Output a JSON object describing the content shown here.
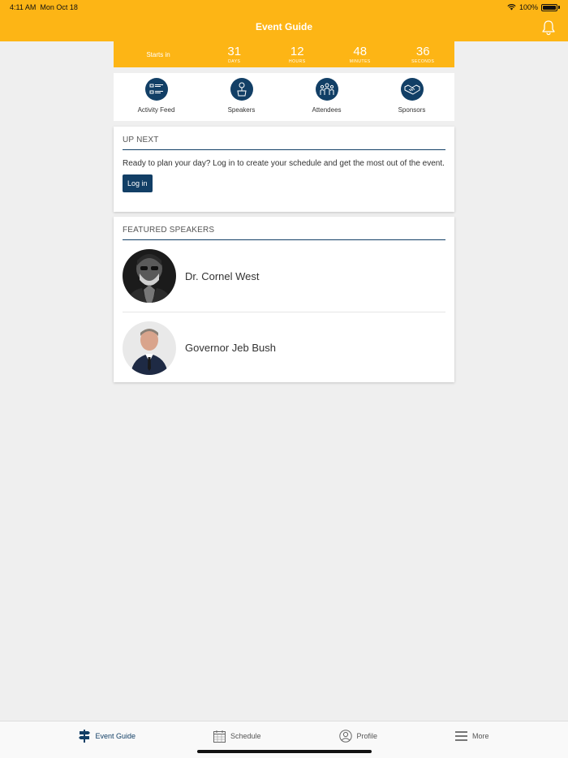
{
  "status": {
    "time": "4:11 AM",
    "date": "Mon Oct 18",
    "battery": "100%"
  },
  "header": {
    "title": "Event Guide"
  },
  "countdown": {
    "label": "Starts in",
    "units": [
      {
        "value": "31",
        "caption": "DAYS"
      },
      {
        "value": "12",
        "caption": "HOURS"
      },
      {
        "value": "48",
        "caption": "MINUTES"
      },
      {
        "value": "36",
        "caption": "SECONDS"
      }
    ]
  },
  "quicklinks": [
    {
      "label": "Activity Feed",
      "icon": "activity-feed-icon"
    },
    {
      "label": "Speakers",
      "icon": "speaker-icon"
    },
    {
      "label": "Attendees",
      "icon": "attendees-icon"
    },
    {
      "label": "Sponsors",
      "icon": "handshake-icon"
    }
  ],
  "upnext": {
    "heading": "UP NEXT",
    "text": "Ready to plan your day? Log in to create your schedule and get the most out of the event.",
    "button": "Log in"
  },
  "featured": {
    "heading": "FEATURED SPEAKERS",
    "speakers": [
      {
        "name": "Dr. Cornel West"
      },
      {
        "name": "Governor Jeb Bush"
      }
    ]
  },
  "tabs": [
    {
      "label": "Event Guide",
      "icon": "signpost-icon"
    },
    {
      "label": "Schedule",
      "icon": "calendar-icon"
    },
    {
      "label": "Profile",
      "icon": "profile-icon"
    },
    {
      "label": "More",
      "icon": "menu-icon"
    }
  ],
  "colors": {
    "accent": "#fdb515",
    "primary": "#123f66",
    "background": "#efefef"
  }
}
